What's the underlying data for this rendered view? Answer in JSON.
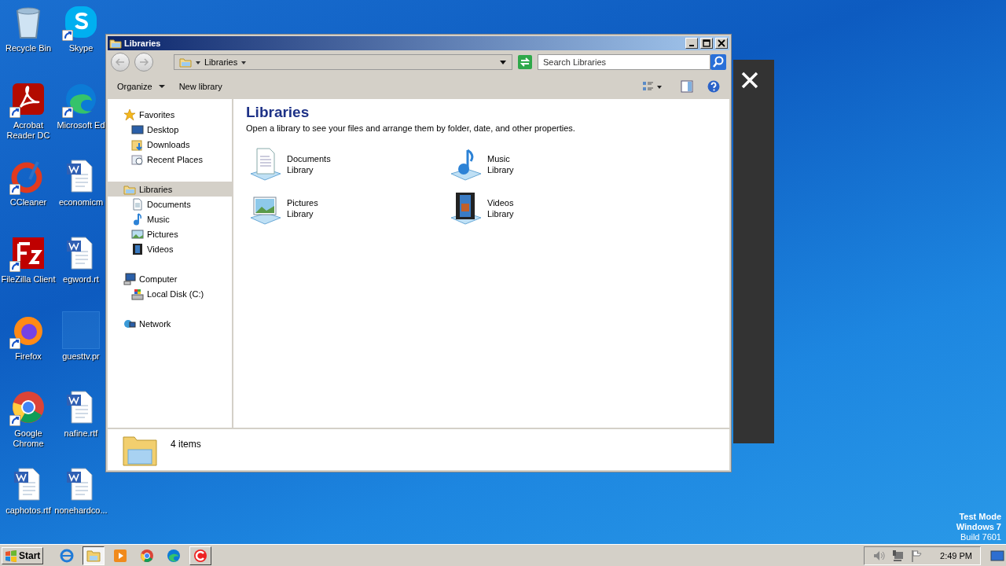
{
  "desktop_icons": [
    {
      "label": "Recycle Bin",
      "kind": "recycle",
      "shortcut": false
    },
    {
      "label": "Acrobat Reader DC",
      "kind": "acrobat",
      "shortcut": true
    },
    {
      "label": "CCleaner",
      "kind": "ccleaner",
      "shortcut": true
    },
    {
      "label": "FileZilla Client",
      "kind": "filezilla",
      "shortcut": true
    },
    {
      "label": "Firefox",
      "kind": "firefox",
      "shortcut": true
    },
    {
      "label": "Google Chrome",
      "kind": "chrome",
      "shortcut": true
    },
    {
      "label": "caphotos.rtf",
      "kind": "doc",
      "shortcut": false
    },
    {
      "label": "Skype",
      "kind": "skype",
      "shortcut": true
    },
    {
      "label": "Microsoft Ed",
      "kind": "edge",
      "shortcut": true
    },
    {
      "label": "economicm",
      "kind": "doc",
      "shortcut": false
    },
    {
      "label": "egword.rt",
      "kind": "doc",
      "shortcut": false
    },
    {
      "label": "guesttv.pr",
      "kind": "blank",
      "shortcut": false
    },
    {
      "label": "nafine.rtf",
      "kind": "doc",
      "shortcut": false
    },
    {
      "label": "nonehardco...",
      "kind": "doc",
      "shortcut": false
    }
  ],
  "window": {
    "title": "Libraries",
    "address": {
      "crumbs": [
        "Libraries"
      ],
      "search_placeholder": "Search Libraries"
    },
    "commands": [
      "Organize",
      "New library"
    ],
    "nav": [
      {
        "label": "Favorites",
        "kind": "star",
        "selected": false,
        "children": [
          {
            "label": "Desktop",
            "kind": "desktop",
            "selected": false
          },
          {
            "label": "Downloads",
            "kind": "downloads",
            "selected": false
          },
          {
            "label": "Recent Places",
            "kind": "recent",
            "selected": false
          }
        ]
      },
      {
        "label": "Libraries",
        "kind": "library",
        "selected": true,
        "children": [
          {
            "label": "Documents",
            "kind": "documents",
            "selected": false
          },
          {
            "label": "Music",
            "kind": "music",
            "selected": false
          },
          {
            "label": "Pictures",
            "kind": "pictures",
            "selected": false
          },
          {
            "label": "Videos",
            "kind": "videos",
            "selected": false
          }
        ]
      },
      {
        "label": "Computer",
        "kind": "computer",
        "selected": false,
        "children": [
          {
            "label": "Local Disk (C:)",
            "kind": "disk",
            "selected": false
          }
        ]
      },
      {
        "label": "Network",
        "kind": "network",
        "selected": false
      }
    ],
    "heading": "Libraries",
    "description": "Open a library to see your files and arrange them by folder, date, and other properties.",
    "libraries": [
      {
        "name": "Documents",
        "type": "Library",
        "kind": "documents"
      },
      {
        "name": "Music",
        "type": "Library",
        "kind": "music"
      },
      {
        "name": "Pictures",
        "type": "Library",
        "kind": "pictures"
      },
      {
        "name": "Videos",
        "type": "Library",
        "kind": "videos"
      }
    ],
    "details": "4 items"
  },
  "taskbar": {
    "start": "Start",
    "apps": [
      {
        "kind": "ie",
        "selected": false,
        "running": false
      },
      {
        "kind": "explorer",
        "selected": true,
        "running": true
      },
      {
        "kind": "media",
        "selected": false,
        "running": false
      },
      {
        "kind": "chrome",
        "selected": false,
        "running": false
      },
      {
        "kind": "edge",
        "selected": false,
        "running": false
      },
      {
        "kind": "ccleaner",
        "selected": false,
        "running": true
      }
    ],
    "time": "2:49 PM"
  },
  "watermark": [
    "Test Mode",
    "Windows 7",
    "Build 7601"
  ]
}
